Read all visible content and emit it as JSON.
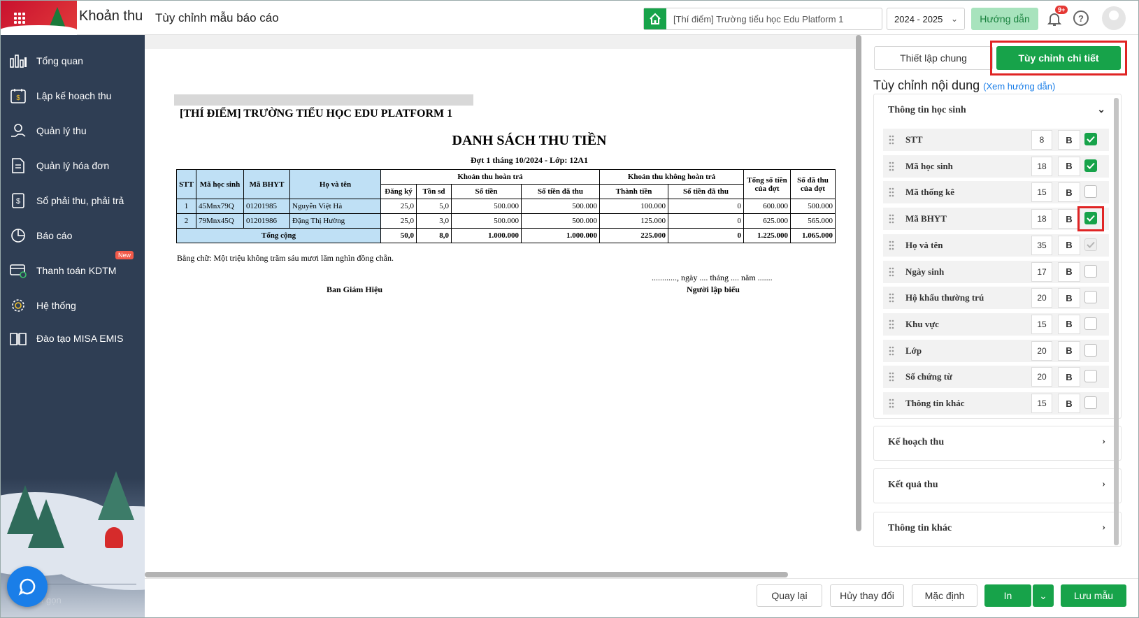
{
  "header": {
    "app_title": "Khoản thu",
    "page_title": "Tùy chỉnh mẫu báo cáo",
    "school": "[Thí điểm] Trường tiểu học Edu Platform 1",
    "year": "2024 - 2025",
    "guide": "Hướng dẫn",
    "notif_count": "9+"
  },
  "sidebar": {
    "items": [
      {
        "label": "Tổng quan",
        "icon": "chart-bars-icon"
      },
      {
        "label": "Lập kế hoạch thu",
        "icon": "calendar-money-icon"
      },
      {
        "label": "Quản lý thu",
        "icon": "hand-money-icon"
      },
      {
        "label": "Quản lý hóa đơn",
        "icon": "invoice-icon"
      },
      {
        "label": "Sổ phải thu, phải trả",
        "icon": "ledger-icon"
      },
      {
        "label": "Báo cáo",
        "icon": "pie-chart-icon"
      },
      {
        "label": "Thanh toán KDTM",
        "icon": "card-payment-icon",
        "badge": "New"
      },
      {
        "label": "Hệ thống",
        "icon": "gear-icon"
      },
      {
        "label": "Đào tạo MISA EMIS",
        "icon": "book-icon"
      }
    ],
    "collapse": "Thu gọn"
  },
  "report": {
    "school_name": "[THÍ ĐIỂM] TRƯỜNG TIỂU HỌC EDU PLATFORM 1",
    "title": "DANH SÁCH THU TIỀN",
    "subtitle": "Đợt 1 tháng 10/2024 - Lớp: 12A1",
    "headers": {
      "stt": "STT",
      "ma_hs": "Mã học sinh",
      "ma_bhyt": "Mã BHYT",
      "ho_ten": "Họ và tên",
      "group1": "Khoản thu hoàn trả",
      "group2": "Khoản thu không hoàn trả",
      "dang_ky": "Đăng ký",
      "ton_sd": "Tồn sd",
      "so_tien": "Số tiền",
      "so_tien_da_thu": "Số tiền đã thu",
      "thanh_tien": "Thành tiền",
      "so_tien_da_thu2": "Số tiền đã thu",
      "tong_so_tien": "Tổng số tiền của đợt",
      "so_da_thu": "Số đã thu của đợt"
    },
    "rows": [
      [
        "1",
        "45Mnx79Q",
        "01201985",
        "Nguyễn Việt Hà",
        "25,0",
        "5,0",
        "500.000",
        "500.000",
        "100.000",
        "0",
        "600.000",
        "500.000"
      ],
      [
        "2",
        "79Mnx45Q",
        "01201986",
        "Đặng Thị Hường",
        "25,0",
        "3,0",
        "500.000",
        "500.000",
        "125.000",
        "0",
        "625.000",
        "565.000"
      ]
    ],
    "total": {
      "label": "Tổng cộng",
      "values": [
        "50,0",
        "8,0",
        "1.000.000",
        "1.000.000",
        "225.000",
        "0",
        "1.225.000",
        "1.065.000"
      ]
    },
    "bang_chu": "Bằng chữ: Một triệu không trăm sáu mươi lăm nghìn đồng chẵn.",
    "sign_left": "Ban Giám Hiệu",
    "sign_date": "............, ngày .... tháng .... năm .......",
    "sign_right": "Người lập biểu"
  },
  "panel": {
    "tab_general": "Thiết lập chung",
    "tab_detail": "Tùy chỉnh chi tiết",
    "section_title": "Tùy chỉnh nội dung",
    "section_link": "(Xem hướng dẫn)",
    "acc1": "Thông tin học sinh",
    "fields": [
      {
        "name": "STT",
        "width": "8",
        "bold": "B",
        "checked": true
      },
      {
        "name": "Mã học sinh",
        "width": "18",
        "bold": "B",
        "checked": true
      },
      {
        "name": "Mã thống kê",
        "width": "15",
        "bold": "B",
        "checked": false
      },
      {
        "name": "Mã BHYT",
        "width": "18",
        "bold": "B",
        "checked": true
      },
      {
        "name": "Họ và tên",
        "width": "35",
        "bold": "B",
        "checked": true,
        "disabled": true
      },
      {
        "name": "Ngày sinh",
        "width": "17",
        "bold": "B",
        "checked": false
      },
      {
        "name": "Hộ khẩu thường trú",
        "width": "20",
        "bold": "B",
        "checked": false
      },
      {
        "name": "Khu vực",
        "width": "15",
        "bold": "B",
        "checked": false
      },
      {
        "name": "Lớp",
        "width": "20",
        "bold": "B",
        "checked": false
      },
      {
        "name": "Số chứng từ",
        "width": "20",
        "bold": "B",
        "checked": false
      },
      {
        "name": "Thông tin khác",
        "width": "15",
        "bold": "B",
        "checked": false
      }
    ],
    "acc2": "Kế hoạch thu",
    "acc3": "Kết quả thu",
    "acc4": "Thông tin khác"
  },
  "footer": {
    "back": "Quay lại",
    "cancel": "Hủy thay đổi",
    "default": "Mặc định",
    "print": "In",
    "save": "Lưu mẫu"
  },
  "colors": {
    "primary": "#17a34a",
    "sidebar": "#2f3e54",
    "highlight": "#e02424"
  }
}
